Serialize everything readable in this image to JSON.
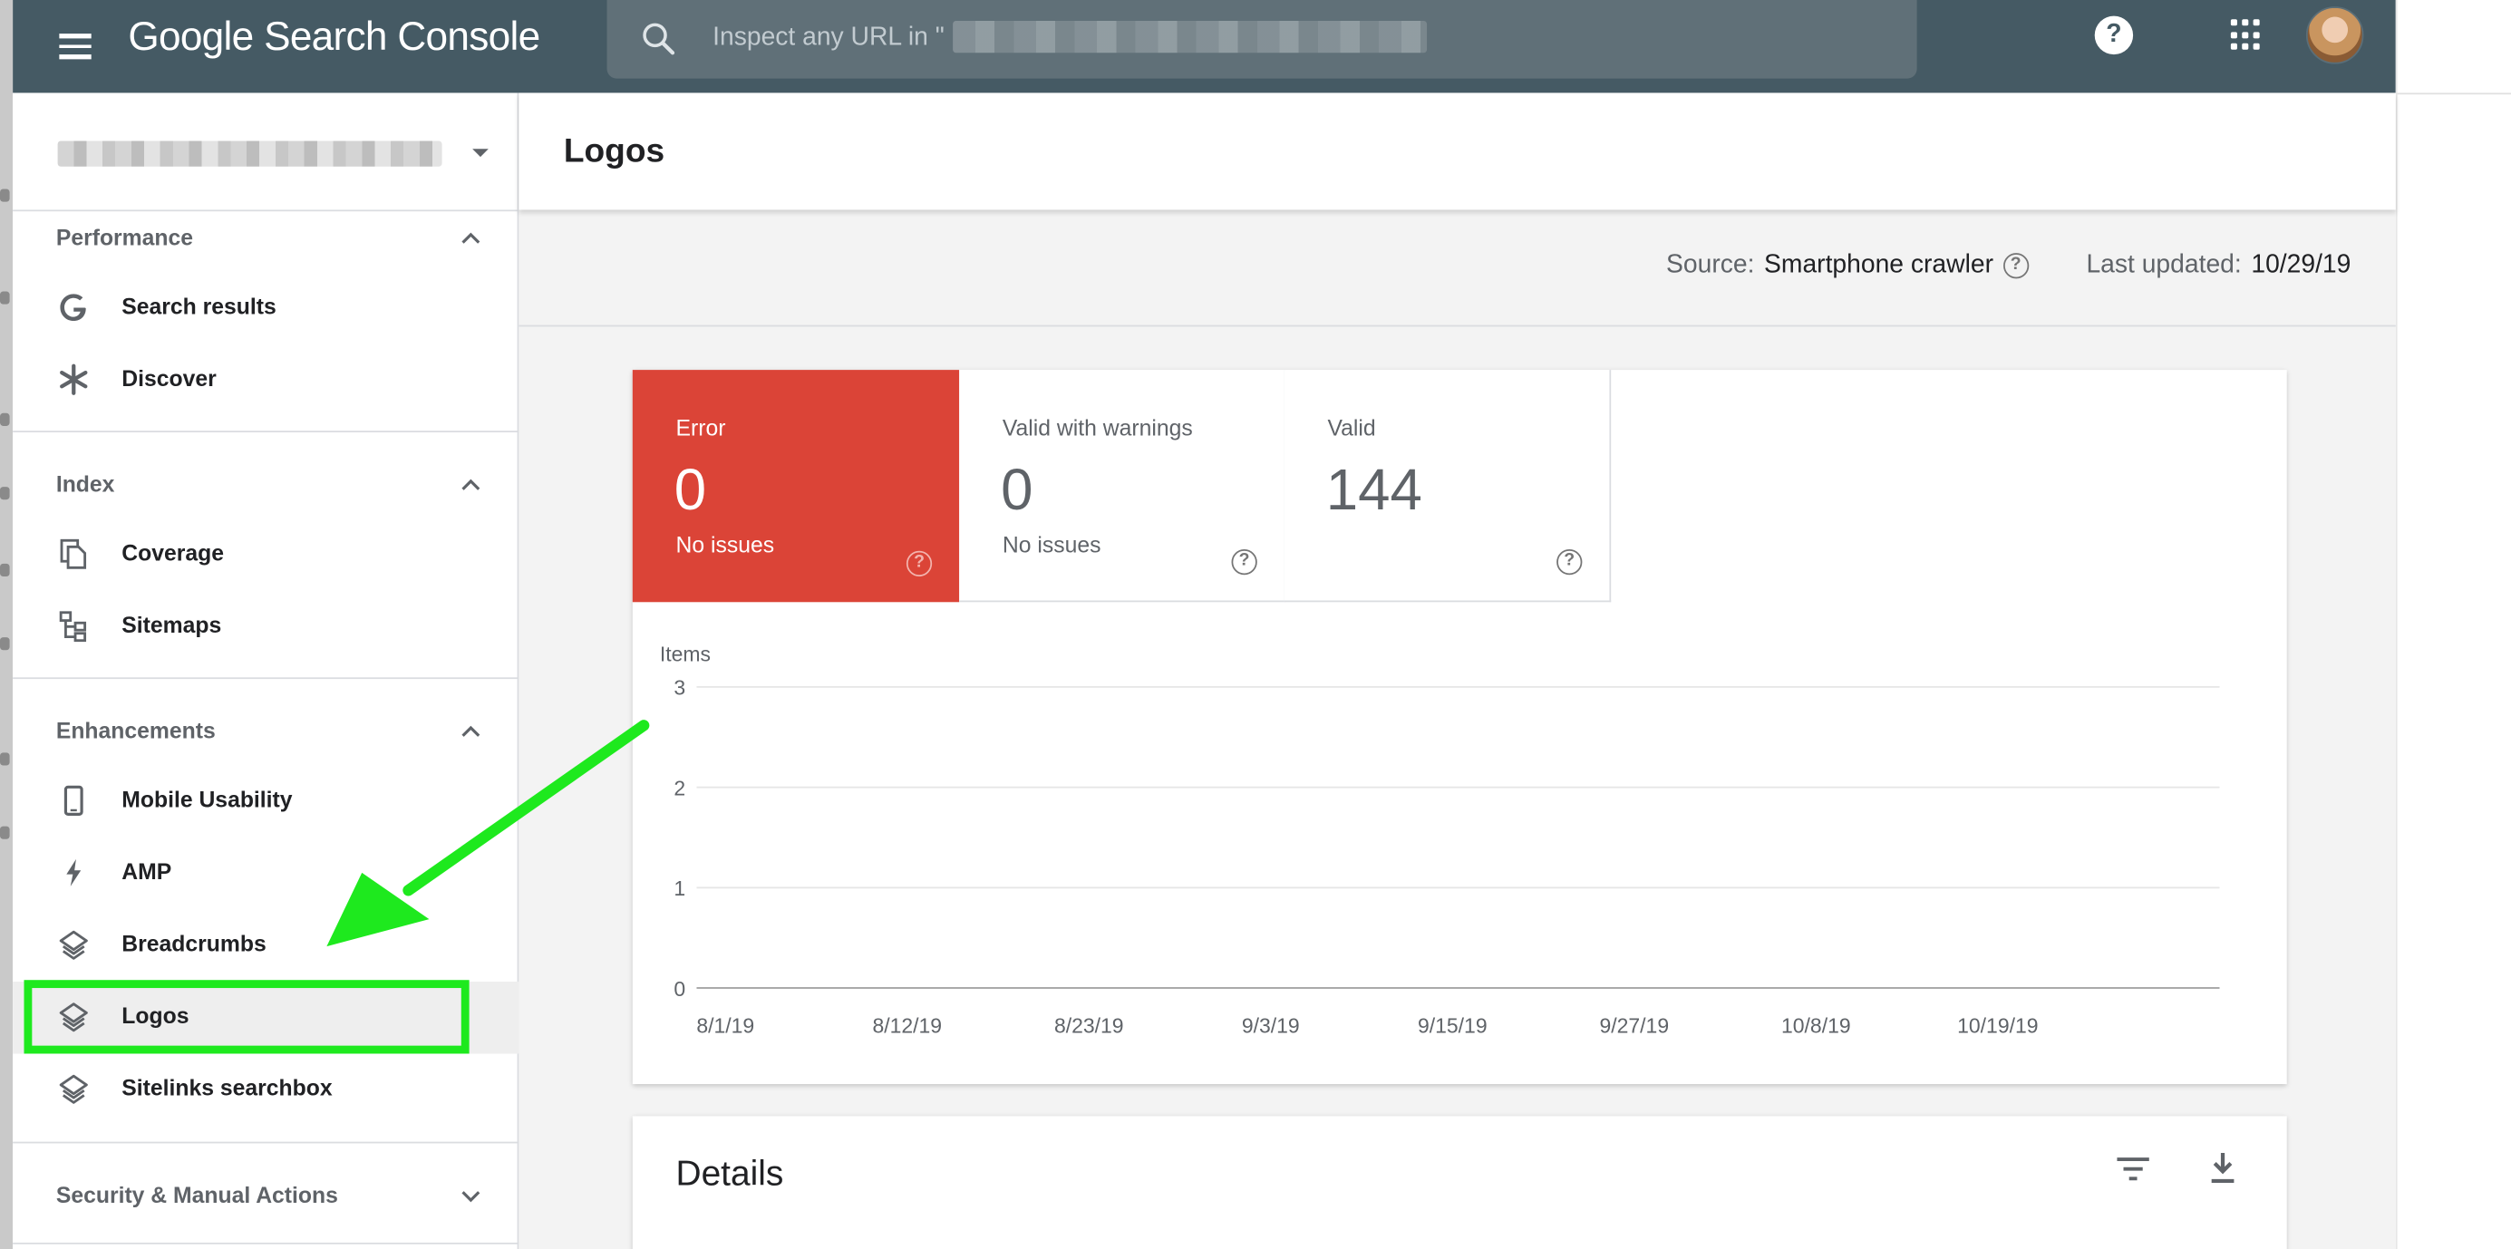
{
  "header": {
    "brand": "Google Search Console",
    "search_placeholder": "Inspect any URL in \""
  },
  "sidebar": {
    "sections": [
      {
        "title": "Performance",
        "items": [
          {
            "label": "Search results",
            "icon": "google-g-icon"
          },
          {
            "label": "Discover",
            "icon": "asterisk-icon"
          }
        ]
      },
      {
        "title": "Index",
        "items": [
          {
            "label": "Coverage",
            "icon": "file-copy-icon"
          },
          {
            "label": "Sitemaps",
            "icon": "sitemap-icon"
          }
        ]
      },
      {
        "title": "Enhancements",
        "items": [
          {
            "label": "Mobile Usability",
            "icon": "phone-icon"
          },
          {
            "label": "AMP",
            "icon": "lightning-icon"
          },
          {
            "label": "Breadcrumbs",
            "icon": "layers-icon"
          },
          {
            "label": "Logos",
            "icon": "layers-icon",
            "active": true
          },
          {
            "label": "Sitelinks searchbox",
            "icon": "layers-icon"
          }
        ]
      },
      {
        "title": "Security & Manual Actions",
        "items": []
      }
    ]
  },
  "page": {
    "title": "Logos",
    "source_label": "Source:",
    "source_value": "Smartphone crawler",
    "updated_label": "Last updated:",
    "updated_value": "10/29/19"
  },
  "tiles": [
    {
      "label": "Error",
      "value": "0",
      "sub": "No issues"
    },
    {
      "label": "Valid with warnings",
      "value": "0",
      "sub": "No issues"
    },
    {
      "label": "Valid",
      "value": "144",
      "sub": ""
    }
  ],
  "chart_data": {
    "type": "line",
    "ylabel": "Items",
    "ylim": [
      0,
      3
    ],
    "yticks": [
      0,
      1,
      2,
      3
    ],
    "x_ticks": [
      "8/1/19",
      "8/12/19",
      "8/23/19",
      "9/3/19",
      "9/15/19",
      "9/27/19",
      "10/8/19",
      "10/19/19"
    ],
    "grid": true
  },
  "details": {
    "title": "Details"
  },
  "colors": {
    "header": "#455a64",
    "error_tile": "#db4437",
    "annotation": "#1ee91e"
  }
}
